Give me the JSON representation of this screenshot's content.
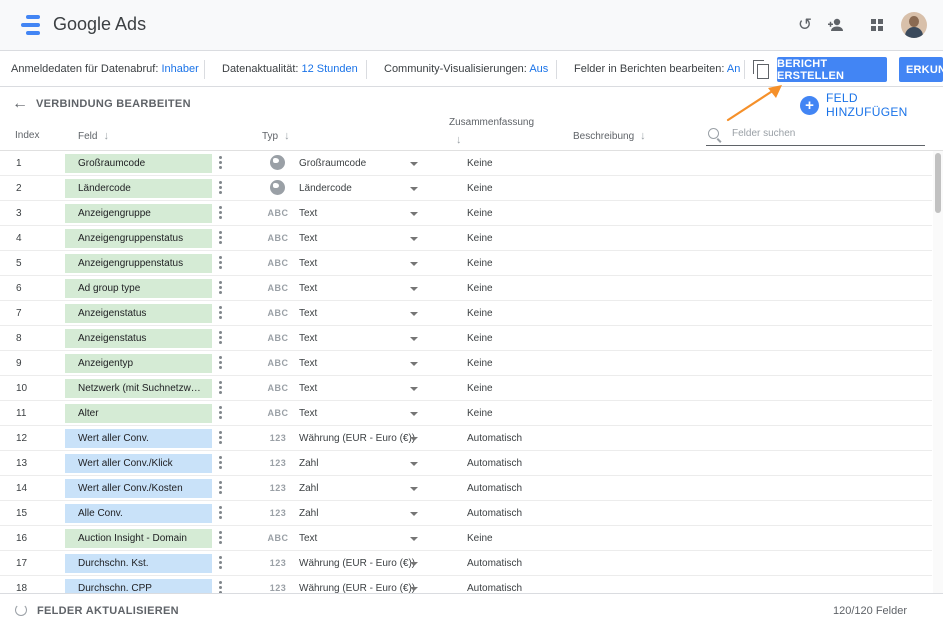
{
  "app": {
    "title": "Google Ads"
  },
  "header_icons": [
    "history-icon",
    "add-person-icon",
    "apps-grid-icon",
    "user-avatar"
  ],
  "infobar": {
    "credentials_label": "Anmeldedaten für Datenabruf:",
    "credentials_value": "Inhaber",
    "freshness_label": "Datenaktualität:",
    "freshness_value": "12 Stunden",
    "community_label": "Community-Visualisierungen:",
    "community_value": "Aus",
    "edit_fields_label": "Felder in Berichten bearbeiten:",
    "edit_fields_value": "An",
    "create_report": "BERICHT ERSTELLEN",
    "explore": "ERKUND"
  },
  "subheader": {
    "back_label": "VERBINDUNG BEARBEITEN",
    "add_field": "FELD HINZUFÜGEN"
  },
  "columns": {
    "index": "Index",
    "field": "Feld",
    "type": "Typ",
    "aggregation": "Zusammenfassung",
    "description": "Beschreibung",
    "search_placeholder": "Felder suchen"
  },
  "rows": [
    {
      "index": "1",
      "field": "Großraumcode",
      "kind": "dimension",
      "type_icon": "globe",
      "type": "Großraumcode",
      "aggregation": "Keine"
    },
    {
      "index": "2",
      "field": "Ländercode",
      "kind": "dimension",
      "type_icon": "globe",
      "type": "Ländercode",
      "aggregation": "Keine"
    },
    {
      "index": "3",
      "field": "Anzeigengruppe",
      "kind": "dimension",
      "type_icon": "ABC",
      "type": "Text",
      "aggregation": "Keine"
    },
    {
      "index": "4",
      "field": "Anzeigengruppenstatus",
      "kind": "dimension",
      "type_icon": "ABC",
      "type": "Text",
      "aggregation": "Keine"
    },
    {
      "index": "5",
      "field": "Anzeigengruppenstatus",
      "kind": "dimension",
      "type_icon": "ABC",
      "type": "Text",
      "aggregation": "Keine"
    },
    {
      "index": "6",
      "field": "Ad group type",
      "kind": "dimension",
      "type_icon": "ABC",
      "type": "Text",
      "aggregation": "Keine"
    },
    {
      "index": "7",
      "field": "Anzeigenstatus",
      "kind": "dimension",
      "type_icon": "ABC",
      "type": "Text",
      "aggregation": "Keine"
    },
    {
      "index": "8",
      "field": "Anzeigenstatus",
      "kind": "dimension",
      "type_icon": "ABC",
      "type": "Text",
      "aggregation": "Keine"
    },
    {
      "index": "9",
      "field": "Anzeigentyp",
      "kind": "dimension",
      "type_icon": "ABC",
      "type": "Text",
      "aggregation": "Keine"
    },
    {
      "index": "10",
      "field": "Netzwerk (mit Suchnetzw…",
      "kind": "dimension",
      "type_icon": "ABC",
      "type": "Text",
      "aggregation": "Keine"
    },
    {
      "index": "11",
      "field": "Alter",
      "kind": "dimension",
      "type_icon": "ABC",
      "type": "Text",
      "aggregation": "Keine"
    },
    {
      "index": "12",
      "field": "Wert aller Conv.",
      "kind": "metric",
      "type_icon": "123",
      "type": "Währung (EUR - Euro (€))",
      "aggregation": "Automatisch"
    },
    {
      "index": "13",
      "field": "Wert aller Conv./Klick",
      "kind": "metric",
      "type_icon": "123",
      "type": "Zahl",
      "aggregation": "Automatisch"
    },
    {
      "index": "14",
      "field": "Wert aller Conv./Kosten",
      "kind": "metric",
      "type_icon": "123",
      "type": "Zahl",
      "aggregation": "Automatisch"
    },
    {
      "index": "15",
      "field": "Alle Conv.",
      "kind": "metric",
      "type_icon": "123",
      "type": "Zahl",
      "aggregation": "Automatisch"
    },
    {
      "index": "16",
      "field": "Auction Insight - Domain",
      "kind": "dimension",
      "type_icon": "ABC",
      "type": "Text",
      "aggregation": "Keine"
    },
    {
      "index": "17",
      "field": "Durchschn. Kst.",
      "kind": "metric",
      "type_icon": "123",
      "type": "Währung (EUR - Euro (€))",
      "aggregation": "Automatisch"
    },
    {
      "index": "18",
      "field": "Durchschn. CPP",
      "kind": "metric",
      "type_icon": "123",
      "type": "Währung (EUR - Euro (€))",
      "aggregation": "Automatisch"
    }
  ],
  "footer": {
    "refresh": "FELDER AKTUALISIEREN",
    "count": "120/120 Felder"
  },
  "colors": {
    "accent": "#4285f4",
    "link": "#1a73e8",
    "dimension_chip": "#d5ebd5",
    "metric_chip": "#c9e2f9",
    "annotation_arrow": "#f5902a"
  }
}
